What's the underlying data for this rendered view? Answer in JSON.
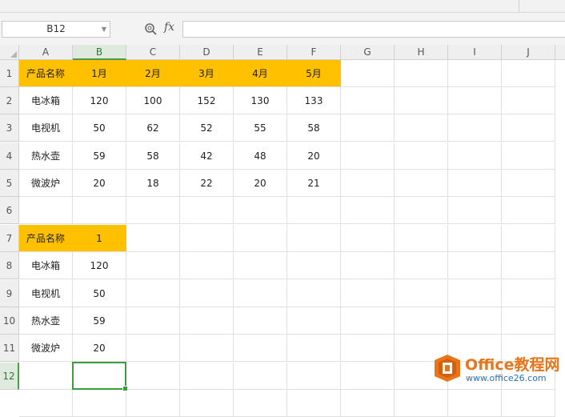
{
  "formula_bar": {
    "name_box": "B12",
    "fx_label": "fx",
    "formula": ""
  },
  "columns": [
    "A",
    "B",
    "C",
    "D",
    "E",
    "F",
    "G",
    "H",
    "I",
    "J"
  ],
  "rows": [
    "1",
    "2",
    "3",
    "4",
    "5",
    "6",
    "7",
    "8",
    "9",
    "10",
    "11",
    "12"
  ],
  "selected": {
    "column": "B",
    "row": "12"
  },
  "cells": {
    "r1": [
      "产品名称",
      "1月",
      "2月",
      "3月",
      "4月",
      "5月"
    ],
    "r2": [
      "电冰箱",
      "120",
      "100",
      "152",
      "130",
      "133"
    ],
    "r3": [
      "电视机",
      "50",
      "62",
      "52",
      "55",
      "58"
    ],
    "r4": [
      "热水壶",
      "59",
      "58",
      "42",
      "48",
      "20"
    ],
    "r5": [
      "微波炉",
      "20",
      "18",
      "22",
      "20",
      "21"
    ],
    "r7": [
      "产品名称",
      "1"
    ],
    "r8": [
      "电冰箱",
      "120"
    ],
    "r9": [
      "电视机",
      "50"
    ],
    "r10": [
      "热水壶",
      "59"
    ],
    "r11": [
      "微波炉",
      "20"
    ]
  },
  "colors": {
    "header_fill": "#ffc000",
    "selection": "#3f9b3f"
  },
  "watermark": {
    "title": "Office教程网",
    "url": "www.office26.com",
    "icon": "office-logo-icon"
  }
}
